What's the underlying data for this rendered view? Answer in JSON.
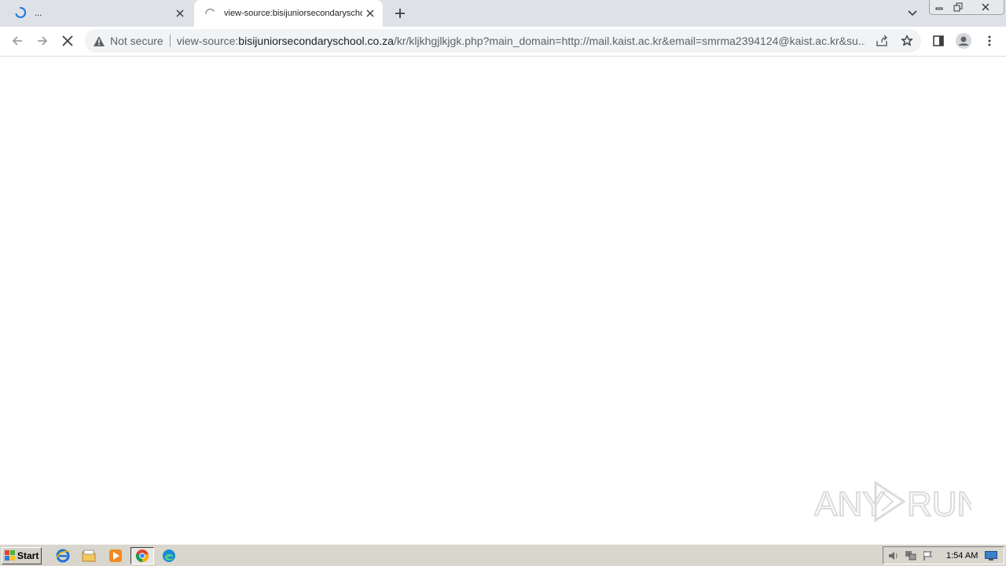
{
  "browser": {
    "tabs": [
      {
        "title": "...",
        "state": "loading"
      },
      {
        "title": "view-source:bisijuniorsecondaryschool.co.za/kr/kljkhgjlkjgk.php",
        "state": "loading"
      }
    ],
    "address_bar": {
      "security_label": "Not secure",
      "url_prefix": "view-source:",
      "url_host": "bisijuniorsecondaryschool.co.za",
      "url_path": "/kr/kljkhgjlkjgk.php?main_domain=http://mail.kaist.ac.kr&email=smrma2394124@kaist.ac.kr&su..."
    }
  },
  "watermark": {
    "text_left": "ANY",
    "text_right": "RUN"
  },
  "taskbar": {
    "start_label": "Start",
    "clock": "1:54 AM",
    "pinned": [
      "internet-explorer-icon",
      "file-explorer-icon",
      "media-player-icon",
      "chrome-icon",
      "edge-icon"
    ]
  }
}
